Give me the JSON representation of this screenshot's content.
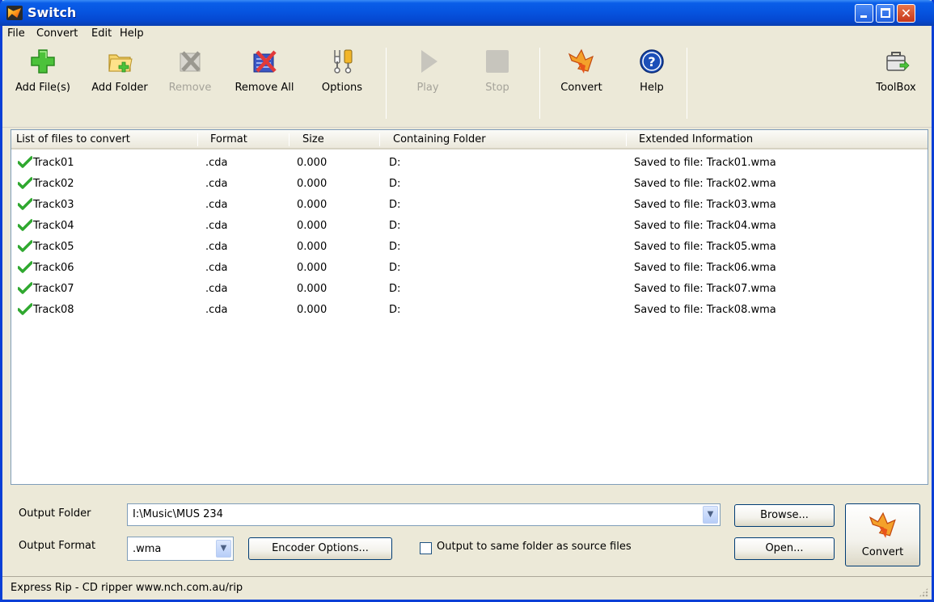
{
  "window": {
    "title": "Switch"
  },
  "menu": [
    "File",
    "Convert",
    "Edit",
    "Help"
  ],
  "toolbar": {
    "add_files": "Add File(s)",
    "add_folder": "Add Folder",
    "remove": "Remove",
    "remove_all": "Remove All",
    "options": "Options",
    "play": "Play",
    "stop": "Stop",
    "convert": "Convert",
    "help": "Help",
    "toolbox": "ToolBox"
  },
  "list": {
    "columns": [
      "List of files to convert",
      "Format",
      "Size",
      "Containing Folder",
      "Extended Information"
    ],
    "rows": [
      {
        "name": "Track01",
        "format": ".cda",
        "size": "0.000",
        "folder": "D:",
        "info": "Saved to file: Track01.wma"
      },
      {
        "name": "Track02",
        "format": ".cda",
        "size": "0.000",
        "folder": "D:",
        "info": "Saved to file: Track02.wma"
      },
      {
        "name": "Track03",
        "format": ".cda",
        "size": "0.000",
        "folder": "D:",
        "info": "Saved to file: Track03.wma"
      },
      {
        "name": "Track04",
        "format": ".cda",
        "size": "0.000",
        "folder": "D:",
        "info": "Saved to file: Track04.wma"
      },
      {
        "name": "Track05",
        "format": ".cda",
        "size": "0.000",
        "folder": "D:",
        "info": "Saved to file: Track05.wma"
      },
      {
        "name": "Track06",
        "format": ".cda",
        "size": "0.000",
        "folder": "D:",
        "info": "Saved to file: Track06.wma"
      },
      {
        "name": "Track07",
        "format": ".cda",
        "size": "0.000",
        "folder": "D:",
        "info": "Saved to file: Track07.wma"
      },
      {
        "name": "Track08",
        "format": ".cda",
        "size": "0.000",
        "folder": "D:",
        "info": "Saved to file: Track08.wma"
      }
    ]
  },
  "output": {
    "folder_label": "Output Folder",
    "folder_value": "I:\\Music\\MUS 234",
    "format_label": "Output Format",
    "format_value": ".wma",
    "encoder_options": "Encoder Options...",
    "same_folder_label": "Output to same folder as source files",
    "same_folder_checked": false,
    "browse": "Browse...",
    "open": "Open...",
    "convert": "Convert"
  },
  "status": {
    "text": "Express Rip - CD ripper www.nch.com.au/rip"
  },
  "icons": {
    "add_files": "plus-icon",
    "add_folder": "folder-add-icon",
    "remove": "remove-icon",
    "remove_all": "remove-all-icon",
    "options": "options-icon",
    "play": "play-icon",
    "stop": "stop-icon",
    "convert": "convert-icon",
    "help": "help-icon",
    "toolbox": "toolbox-icon",
    "row_status": "checkmark-icon"
  },
  "colors": {
    "titlebar": "#0654e0",
    "check": "#2fa82f",
    "convert_orange": "#f07a12"
  }
}
